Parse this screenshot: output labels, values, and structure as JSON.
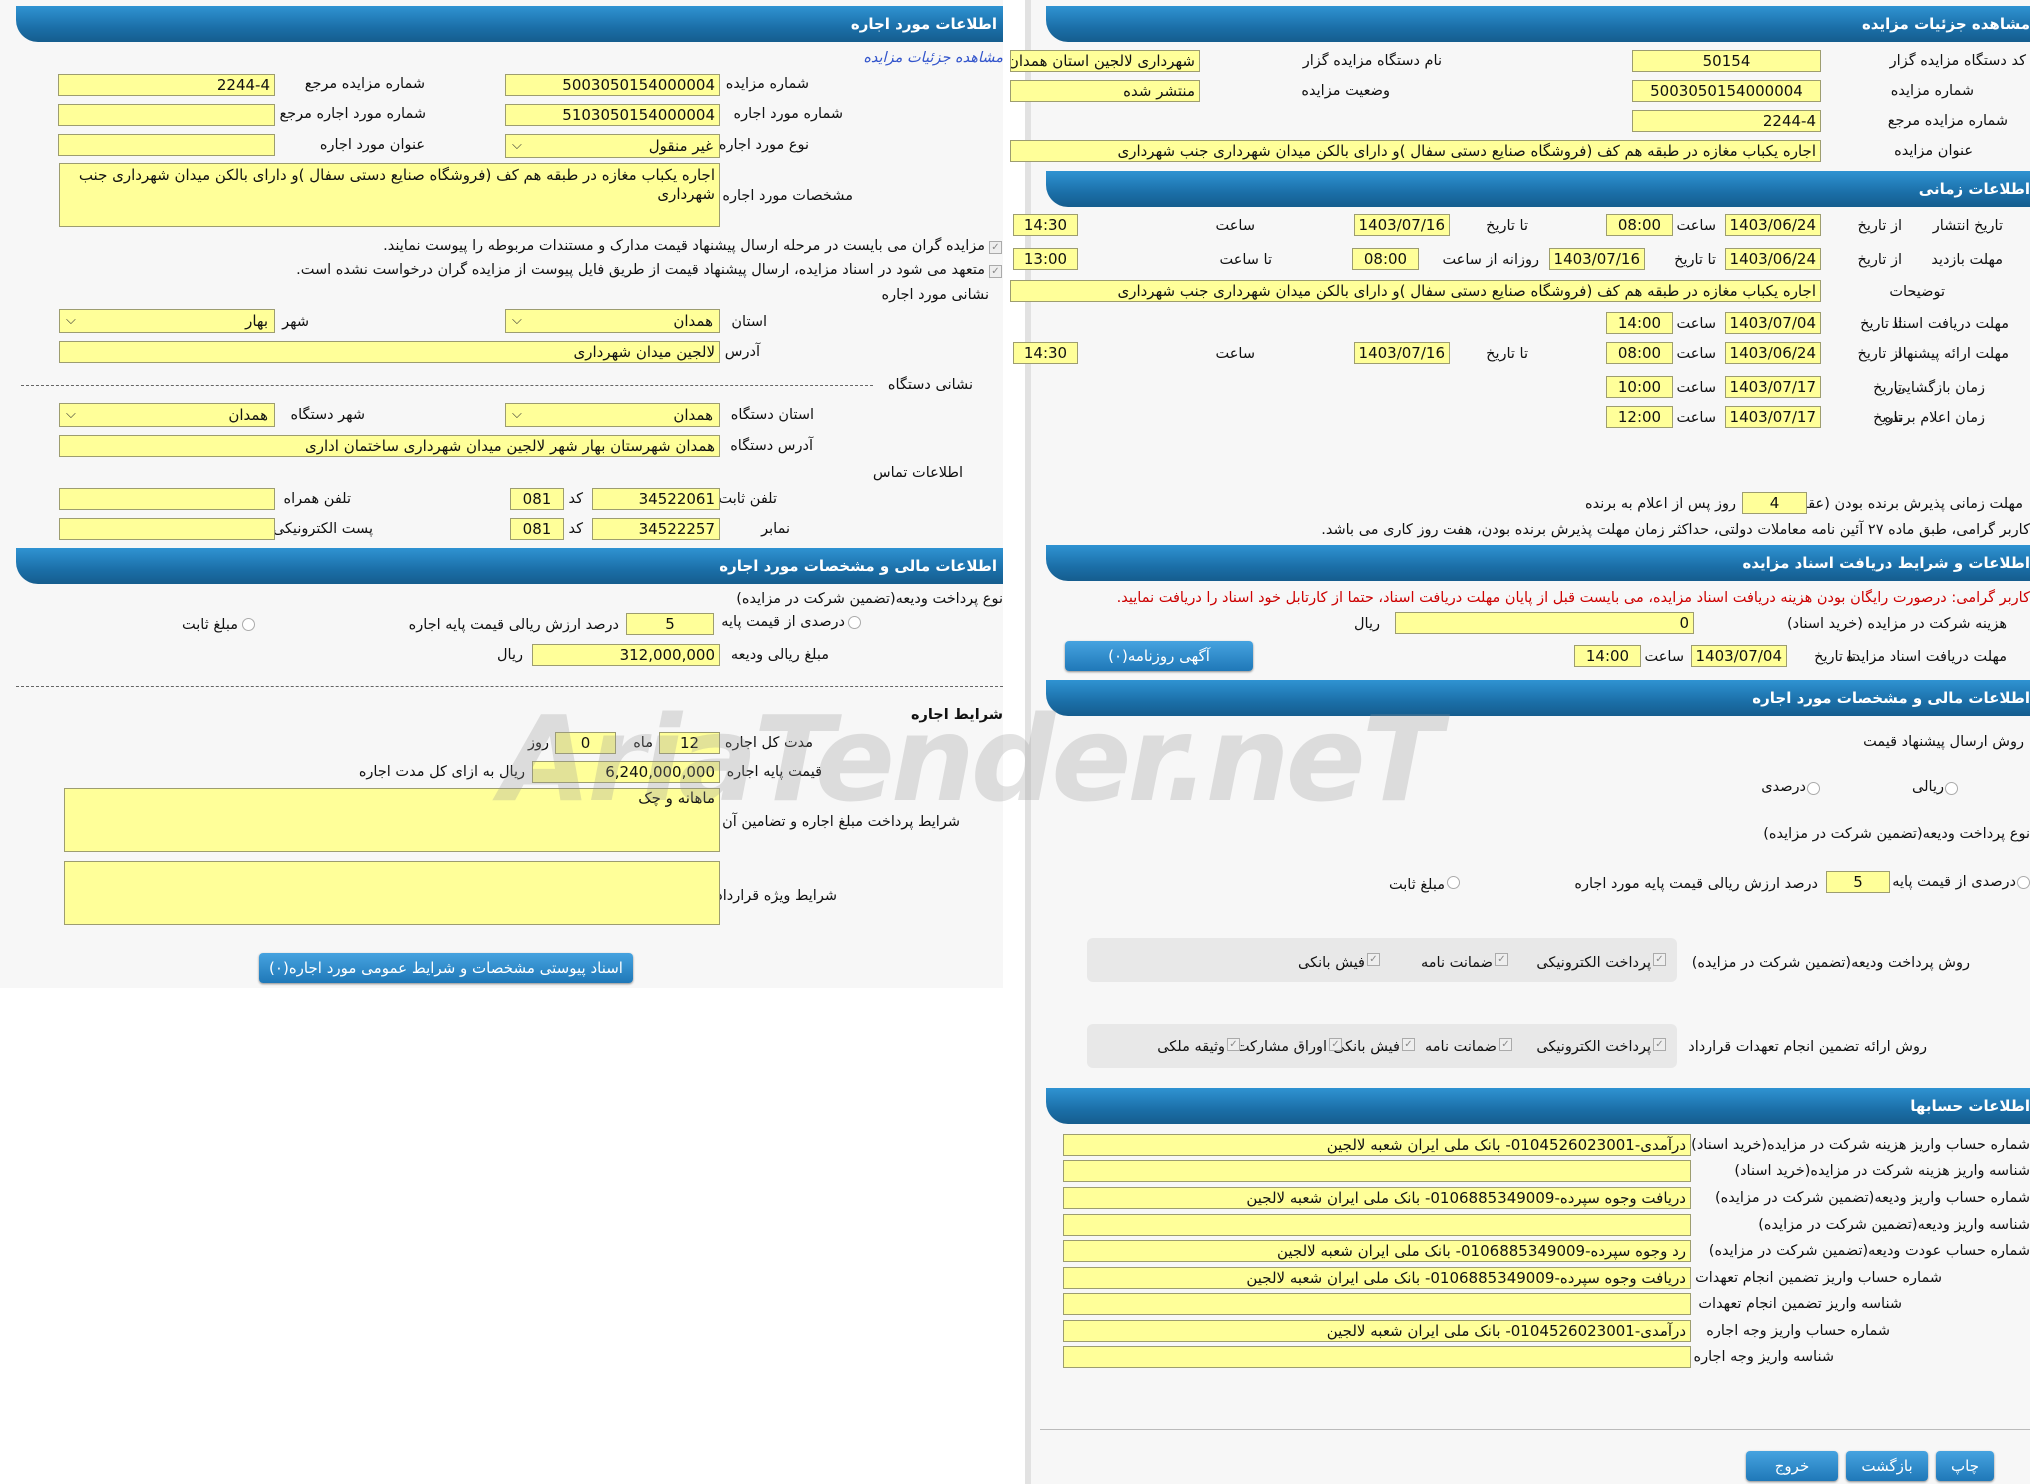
{
  "left": {
    "h_lease_info": "اطلاعات مورد اجاره",
    "view_link": "مشاهده جزئیات مزایده",
    "l_auction_no": "شماره مزایده",
    "v_auction_no": "5003050154000004",
    "l_ref_auction": "شماره مزایده مرجع",
    "v_ref_auction": "2244-4",
    "l_lease_no": "شماره مورد اجاره",
    "v_lease_no": "5103050154000004",
    "l_ref_lease": "شماره مورد اجاره مرجع",
    "v_ref_lease": "",
    "l_lease_type": "نوع مورد اجاره",
    "v_lease_type": "غیر منقول",
    "l_lease_title": "عنوان مورد اجاره",
    "v_lease_title": "",
    "l_lease_specs": "مشخصات مورد اجاره",
    "v_lease_specs": "اجاره یکباب مغازه  در  طبقه هم کف (فروشگاه صنایع دستی سفال )و دارای  بالکن میدان شهرداری جنب شهرداری",
    "check1": "مزایده گران می بایست در مرحله ارسال پیشنهاد قیمت مدارک و مستندات مربوطه را پیوست نمایند.",
    "check2": "متعهد می شود در اسناد مزایده، ارسال پیشنهاد قیمت از طریق فایل پیوست از مزایده گران درخواست نشده است.",
    "l_lease_address_title": "نشانی مورد اجاره",
    "l_province": "استان",
    "v_province": "همدان",
    "l_city": "شهر",
    "v_city": "بهار",
    "l_address": "آدرس",
    "v_address": "لالجین میدان شهرداری",
    "l_org_address_title": "نشانی دستگاه",
    "l_org_province": "استان دستگاه",
    "v_org_province": "همدان",
    "l_org_city": "شهر دستگاه",
    "v_org_city": "همدان",
    "l_org_address": "آدرس دستگاه",
    "v_org_address": "همدان شهرستان بهار شهر لالجین میدان شهرداری ساختمان اداری",
    "l_contact": "اطلاعات تماس",
    "l_phone": "تلفن ثابت",
    "v_phone": "34522061",
    "l_code": "کد",
    "v_phone_code": "081",
    "l_mobile": "تلفن همراه",
    "v_mobile": "",
    "l_fax": "نمابر",
    "v_fax": "34522257",
    "v_fax_code": "081",
    "l_email": "پست الکترونیکی",
    "v_email": "",
    "h_financial": "اطلاعات مالی و مشخصات مورد اجاره",
    "l_deposit_type": "نوع پرداخت ودیعه(تضمین شرکت در مزایده)",
    "r_percent_base": "درصدی از قیمت پایه",
    "v_percent": "5",
    "l_percent_of": "درصد ارزش ریالی قیمت پایه اجاره",
    "r_fixed": "مبلغ ثابت",
    "l_deposit_amount": "مبلغ ریالی ودیعه",
    "v_deposit_amount": "312,000,000",
    "u_rial": "ریال",
    "h_lease_terms": "شرایط اجاره",
    "l_duration": "مدت کل اجاره",
    "v_months": "12",
    "u_month": "ماه",
    "v_days": "0",
    "u_day": "روز",
    "l_base_price": "قیمت پایه اجاره",
    "v_base_price": "6,240,000,000",
    "u_base_price": "ریال به ازای کل مدت اجاره",
    "l_payment_terms": "شرایط پرداخت مبلغ اجاره و تضامین آن",
    "v_payment_terms": "ماهانه و چک",
    "l_special_terms": "شرایط ویژه قرارداد",
    "v_special_terms": "",
    "btn_docs": "اسناد پیوستی مشخصات و شرایط عمومی مورد اجاره(۰)"
  },
  "right": {
    "h_auction_details": "مشاهده جزئیات مزایده",
    "l_org_code": "کد دستگاه مزایده گزار",
    "v_org_code": "50154",
    "l_org_name": "نام دستگاه مزایده گزار",
    "v_org_name": "شهرداری لالجین استان همدان",
    "l_auction_no": "شماره مزایده",
    "v_auction_no": "5003050154000004",
    "l_status": "وضعیت مزایده",
    "v_status": "منتشر شده",
    "l_ref_no": "شماره مزایده مرجع",
    "v_ref_no": "2244-4",
    "l_title": "عنوان مزایده",
    "v_title": "اجاره یکباب مغازه  در  طبقه هم کف (فروشگاه صنایع دستی سفال )و دارای  بالکن میدان شهرداری جنب شهرداری",
    "h_time_info": "اطلاعات زمانی",
    "l_publish_date": "تاریخ انتشار",
    "l_from_date": "از تاریخ",
    "l_to_date": "تا تاریخ",
    "l_hour": "ساعت",
    "v_pub_from": "1403/06/24",
    "v_pub_from_time": "08:00",
    "v_pub_to": "1403/07/16",
    "v_pub_to_time": "14:30",
    "l_visit": "مهلت بازدید",
    "v_visit_from": "1403/06/24",
    "v_visit_to": "1403/07/16",
    "l_daily_from": "روزانه از ساعت",
    "v_daily_from": "08:00",
    "l_to_hour": "تا ساعت",
    "v_daily_to": "13:00",
    "l_notes": "توضیحات",
    "v_notes": "اجاره یکباب مغازه  در  طبقه هم کف (فروشگاه صنایع دستی سفال )و دارای  بالکن میدان شهرداری جنب شهرداری",
    "l_doc_deadline": "مهلت دریافت اسناد",
    "v_doc_to": "1403/07/04",
    "v_doc_to_time": "14:00",
    "l_offer_deadline": "مهلت ارائه پیشنهاد",
    "v_offer_from": "1403/06/24",
    "v_offer_from_time": "08:00",
    "v_offer_to": "1403/07/16",
    "v_offer_to_time": "14:30",
    "l_opening": "زمان بازگشایی",
    "l_date": "تاریخ",
    "v_open_date": "1403/07/17",
    "v_open_time": "10:00",
    "l_winner": "زمان اعلام برنده",
    "v_win_date": "1403/07/17",
    "v_win_time": "12:00",
    "l_acceptance": "مهلت زمانی پذیرش برنده بودن (عقد قرارداد)",
    "v_acceptance_days": "4",
    "u_acceptance": "روز پس از اعلام به برنده",
    "note_acceptance": "کاربر گرامی، طبق ماده ۲۷ آئین نامه معاملات دولتی، حداکثر زمان مهلت پذیرش برنده بودن، هفت روز کاری می باشد.",
    "h_doc_terms": "اطلاعات و شرایط دریافت اسناد مزایده",
    "note_docs": "کاربر گرامی: درصورت رایگان بودن هزینه دریافت اسناد مزایده، می بایست قبل از پایان مهلت دریافت اسناد، حتما از کارتابل خود اسناد را دریافت نمایید.",
    "l_fee": "هزینه شرکت در مزایده (خرید اسناد)",
    "v_fee": "0",
    "u_rial": "ریال",
    "l_doc_receive_deadline": "مهلت دریافت اسناد مزایده",
    "btn_newspaper": "آگهی روزنامه(۰)",
    "h_financial": "اطلاعات مالی و مشخصات مورد اجاره",
    "l_offer_method": "روش ارسال پیشنهاد قیمت",
    "r_rial": "ریالی",
    "r_percent": "درصدی",
    "l_deposit_type": "نوع پرداخت ودیعه(تضمین شرکت در مزایده)",
    "r_percent_base": "درصدی از قیمت پایه",
    "v_percent": "5",
    "l_percent_of": "درصد ارزش ریالی قیمت پایه مورد اجاره",
    "r_fixed": "مبلغ ثابت",
    "l_deposit_method": "روش پرداخت ودیعه(تضمین شرکت در مزایده)",
    "c_electronic": "پرداخت الکترونیکی",
    "c_guarantee": "ضمانت نامه",
    "c_bank_slip": "فیش بانکی",
    "l_contract_guarantee": "روش ارائه تضمین انجام تعهدات قرارداد",
    "c_bonds": "اوراق مشارکت",
    "c_property": "وثیقه ملکی",
    "h_accounts": "اطلاعات حسابها",
    "accounts": [
      {
        "label": "شماره حساب واریز هزینه شرکت در مزایده(خرید اسناد)",
        "value": "درآمدی-0104526023001- بانک ملی ایران شعبه لالجین"
      },
      {
        "label": "شناسه واریز هزینه شرکت در مزایده(خرید اسناد)",
        "value": ""
      },
      {
        "label": "شماره حساب واریز ودیعه(تضمین شرکت در مزایده)",
        "value": "دریافت وجوه سپرده-0106885349009- بانک ملی ایران شعبه لالجین"
      },
      {
        "label": "شناسه واریز ودیعه(تضمین شرکت در مزایده)",
        "value": ""
      },
      {
        "label": "شماره حساب عودت ودیعه(تضمین شرکت در مزایده)",
        "value": "رد وجوه سپرده-0106885349009- بانک ملی ایران شعبه لالجین"
      },
      {
        "label": "شماره حساب واریز تضمین انجام تعهدات",
        "value": "دریافت وجوه سپرده-0106885349009- بانک ملی ایران شعبه لالجین"
      },
      {
        "label": "شناسه واریز تضمین انجام تعهدات",
        "value": ""
      },
      {
        "label": "شماره حساب واریز وجه اجاره",
        "value": "درآمدی-0104526023001- بانک ملی ایران شعبه لالجین"
      },
      {
        "label": "شناسه واریز وجه اجاره",
        "value": ""
      }
    ],
    "btn_print": "چاپ",
    "btn_back": "بازگشت",
    "btn_exit": "خروج"
  },
  "watermark": "AriaTender.neT"
}
